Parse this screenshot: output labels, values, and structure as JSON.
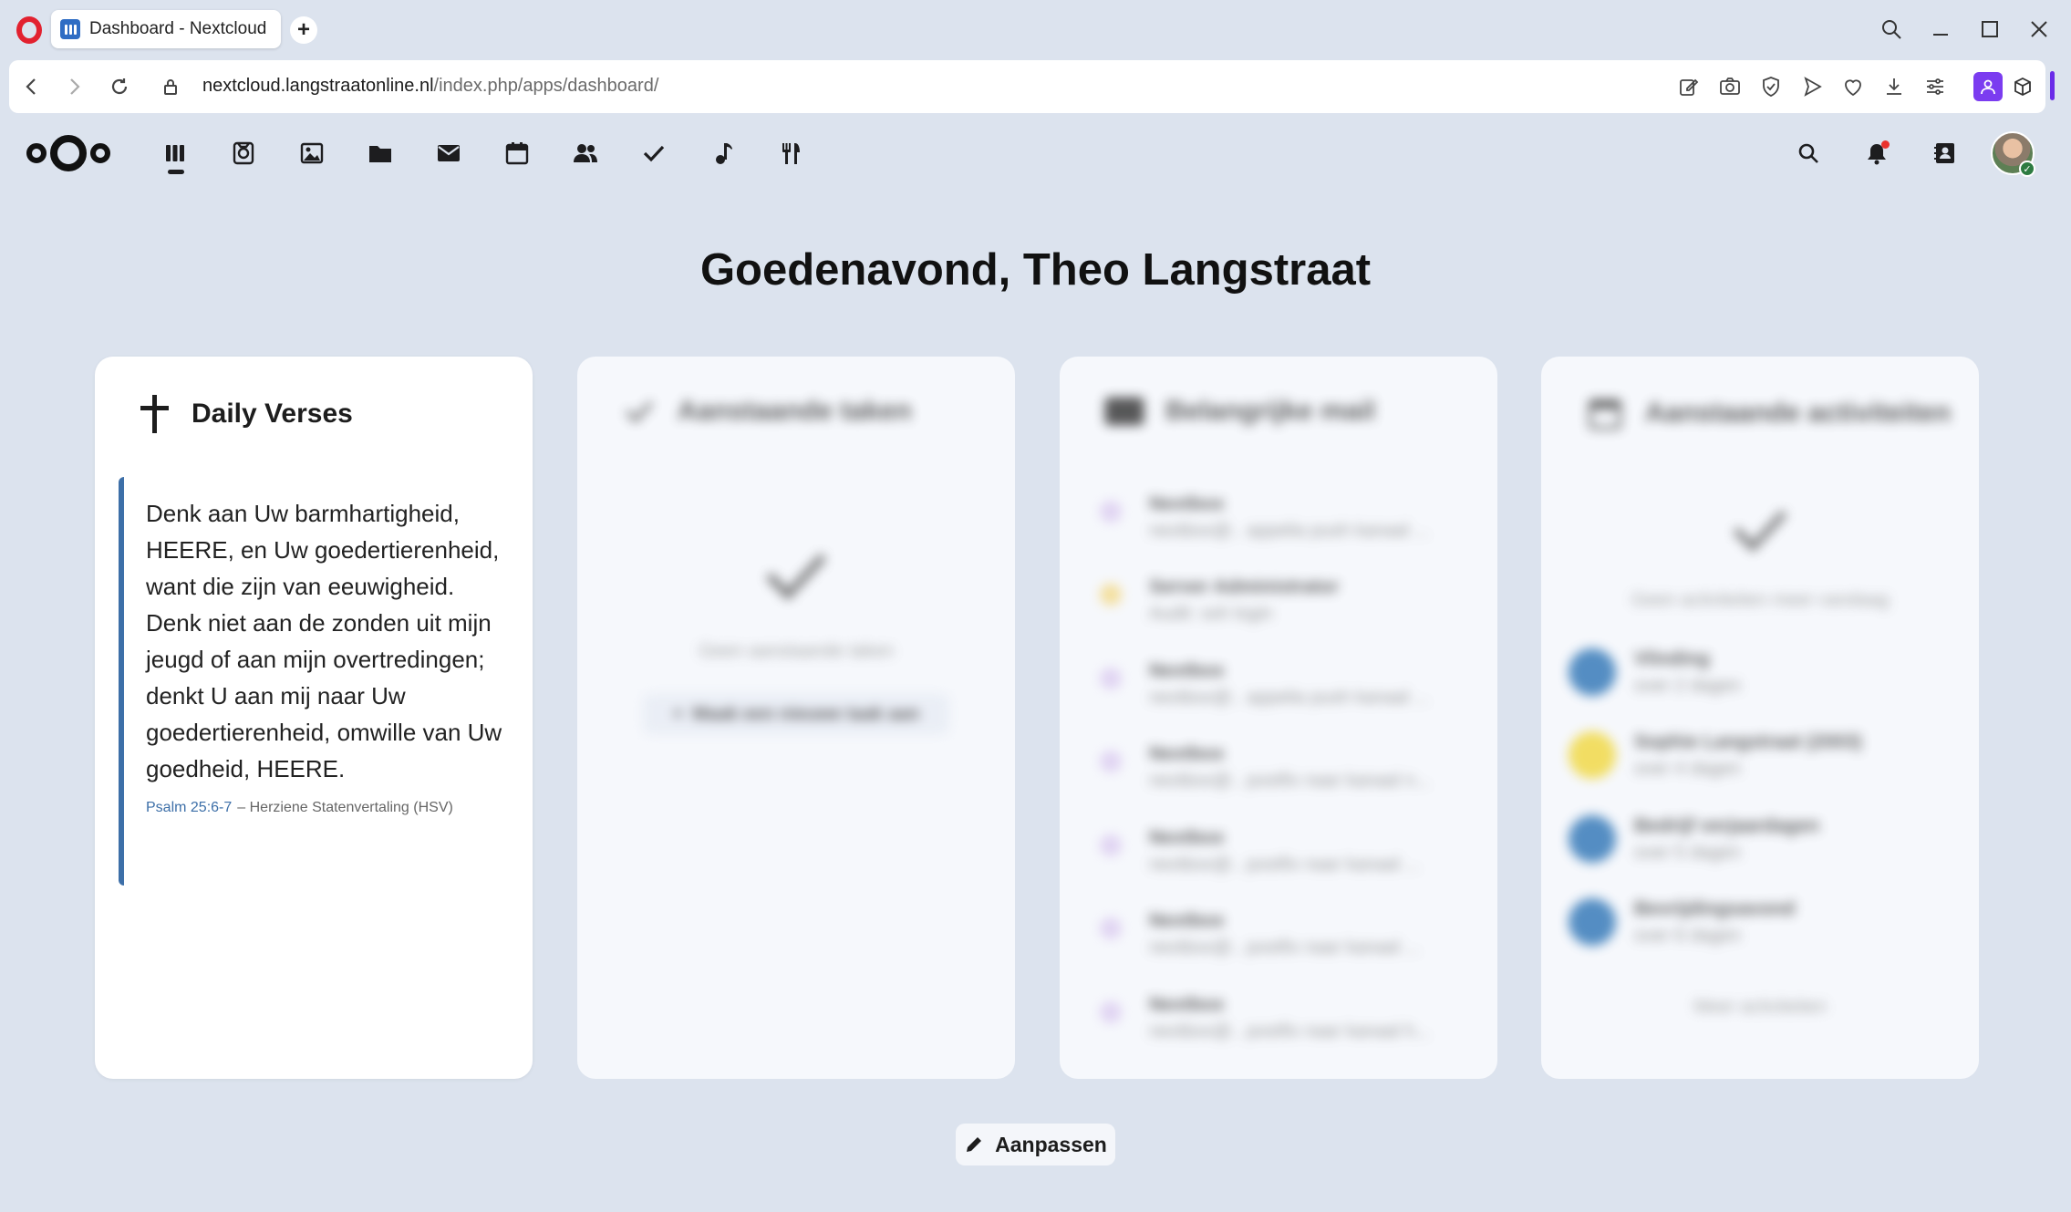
{
  "browser": {
    "tab_title": "Dashboard - Nextcloud",
    "new_tab_symbol": "+",
    "url_host": "nextcloud.langstraatonline.nl",
    "url_path": "/index.php/apps/dashboard/",
    "icons": [
      "search-icon",
      "minimize-icon",
      "maximize-icon",
      "close-icon",
      "back-icon",
      "forward-icon",
      "reload-icon",
      "lock-icon",
      "edit-icon",
      "camera-icon",
      "shield-icon",
      "send-icon",
      "heart-icon",
      "download-icon",
      "menu-icon",
      "profile-icon",
      "box-icon"
    ],
    "accent": "#7b3cf0"
  },
  "header": {
    "apps": [
      "dashboard",
      "activity",
      "photos",
      "files",
      "mail",
      "calendar",
      "contacts",
      "tasks",
      "music",
      "cookbook"
    ],
    "right_icons": [
      "search-icon",
      "notifications-icon",
      "contacts-menu-icon",
      "avatar"
    ]
  },
  "dashboard": {
    "greeting": "Goedenavond, Theo Langstraat",
    "customize_label": "Aanpassen"
  },
  "widgets": {
    "verses": {
      "title": "Daily Verses",
      "text": "Denk aan Uw barmhartigheid, HEERE, en Uw goedertierenheid, want die zijn van eeuwigheid. Denk niet aan de zonden uit mijn jeugd of aan mijn overtredingen; denkt U aan mij naar Uw goedertierenheid, omwille van Uw goedheid, HEERE.",
      "reference": "Psalm 25:6-7",
      "translation": "– Herziene Statenvertaling (HSV)"
    },
    "tasks": {
      "title": "Aanstaande taken",
      "empty": "Geen aanstaande taken",
      "add": "Maak een nieuwe taak aan"
    },
    "mail": {
      "title": "Belangrijke mail",
      "items": [
        {
          "from": "Nextbox",
          "subject": "nextbox@.. appelia push kanaal ..."
        },
        {
          "from": "Server Administrator",
          "subject": "Audit: ssh login"
        },
        {
          "from": "Nextbox",
          "subject": "nextbox@.. appelia push kanaal ..."
        },
        {
          "from": "Nextbox",
          "subject": "nextbox@.. postfix naar kanaal n..."
        },
        {
          "from": "Nextbox",
          "subject": "nextbox@.. postfix naar kanaal ..."
        },
        {
          "from": "Nextbox",
          "subject": "nextbox@.. postfix naar kanaal ..."
        },
        {
          "from": "Nextbox",
          "subject": "nextbox@.. postfix naar kanaal h..."
        }
      ]
    },
    "events": {
      "title": "Aanstaande activiteiten",
      "empty": "Geen activiteiten meer vandaag",
      "items": [
        {
          "title": "Vlinding",
          "when": "over 2 dagen"
        },
        {
          "title": "Sophie Langstraat (2003)",
          "when": "over 4 dagen"
        },
        {
          "title": "Bedrijf verjaardagen",
          "when": "over 5 dagen"
        },
        {
          "title": "Bevrijdingsavond",
          "when": "over 6 dagen"
        }
      ],
      "more": "Meer activiteiten"
    }
  }
}
